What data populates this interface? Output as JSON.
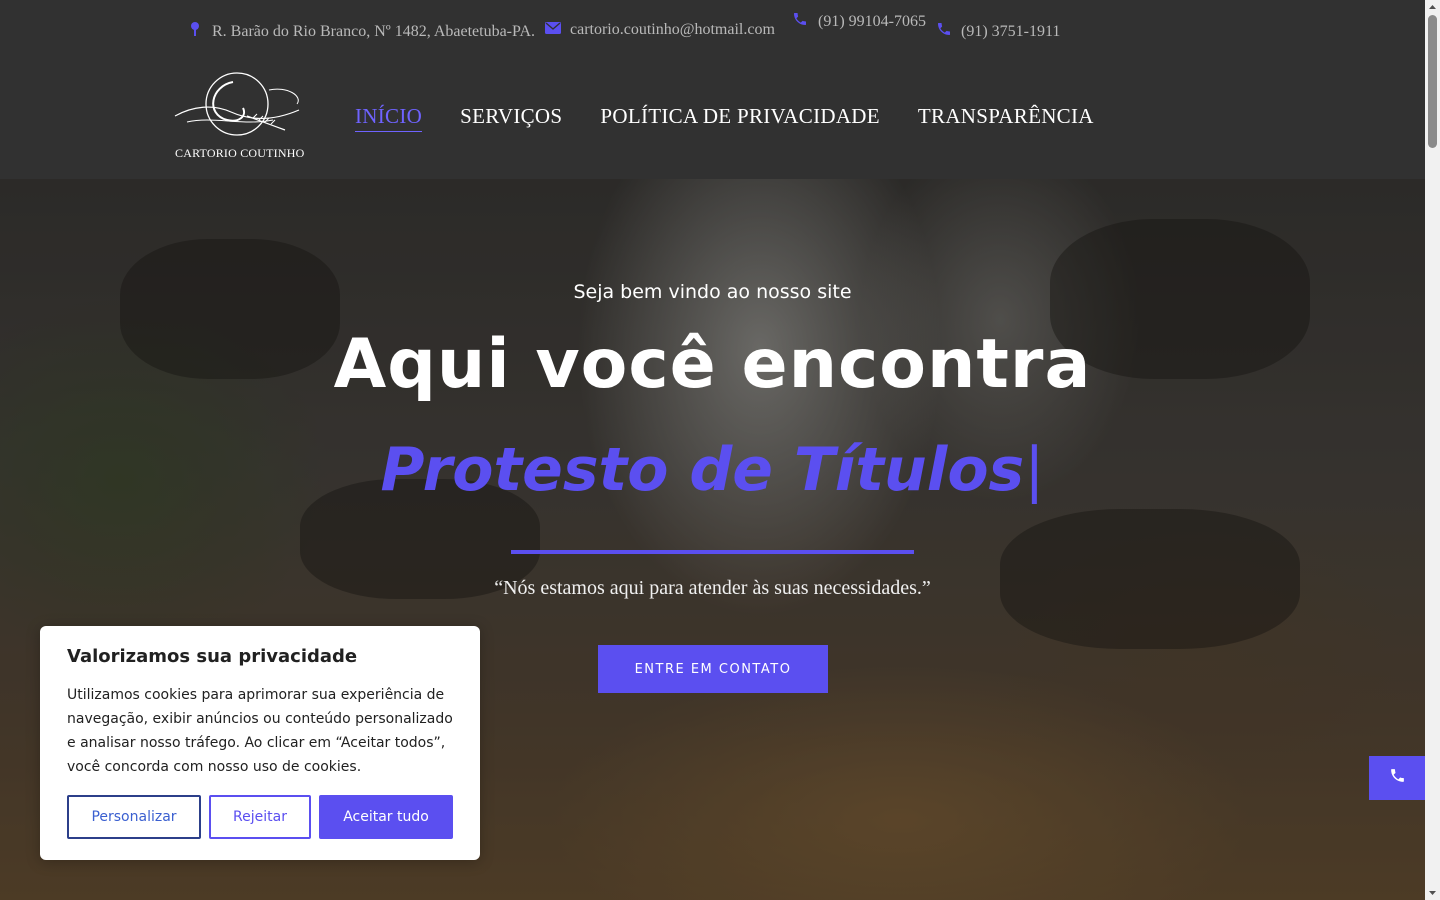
{
  "topbar": {
    "address": "R. Barão do Rio Branco, Nº 1482, Abaetetuba-PA.",
    "email": "cartorio.coutinho@hotmail.com",
    "phone_mobile": "(91) 99104-7065",
    "phone_landline": "(91) 3751-1911",
    "icons": [
      "map-pin-icon",
      "envelope-icon",
      "phone-icon",
      "phone-icon"
    ]
  },
  "logo": {
    "text": "CARTORIO COUTINHO"
  },
  "nav": {
    "items": [
      {
        "label": "INÍCIO",
        "active": true
      },
      {
        "label": "SERVIÇOS",
        "active": false
      },
      {
        "label": "POLÍTICA DE PRIVACIDADE",
        "active": false
      },
      {
        "label": "TRANSPARÊNCIA",
        "active": false
      }
    ]
  },
  "hero": {
    "subtitle": "Seja bem vindo ao nosso site",
    "title": "Aqui você encontra",
    "typed_text": "Protesto de Títulos",
    "cursor": "|",
    "quote": "“Nós estamos aqui para atender às suas necessidades.”",
    "button_label": "ENTRE EM CONTATO"
  },
  "cookie": {
    "title": "Valorizamos sua privacidade",
    "text": "Utilizamos cookies para aprimorar sua experiência de navegação, exibir anúncios ou conteúdo personalizado e analisar nosso tráfego. Ao clicar em “Aceitar todos”, você concorda com nosso uso de cookies.",
    "customize_label": "Personalizar",
    "reject_label": "Rejeitar",
    "accept_label": "Aceitar tudo"
  },
  "colors": {
    "accent": "#5b4ff0",
    "header_bg": "#313131",
    "nav_active": "#6f63ff"
  }
}
